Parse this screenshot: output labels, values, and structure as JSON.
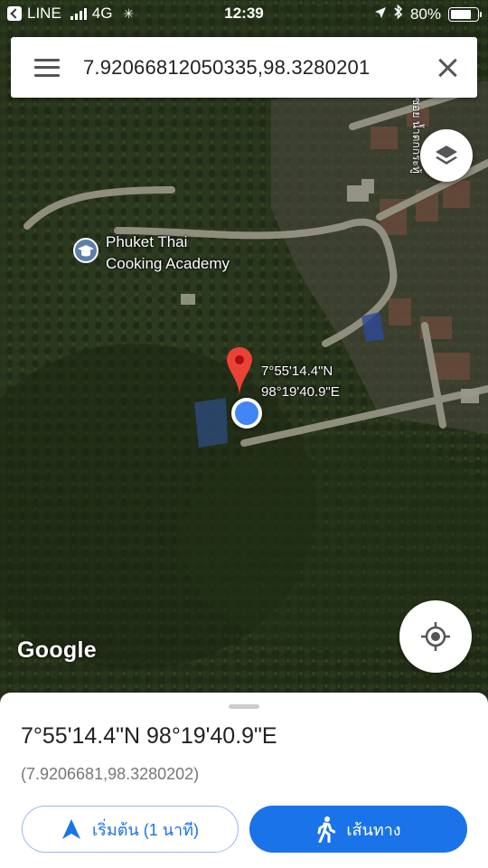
{
  "status_bar": {
    "back_app": "LINE",
    "network": "4G",
    "time": "12:39",
    "battery": "80%",
    "battery_level": 0.8
  },
  "search": {
    "query": "7.92066812050335,98.3280201"
  },
  "map": {
    "poi_name_line1": "Phuket Thai",
    "poi_name_line2": "Cooking Academy",
    "pin_label_line1": "7°55'14.4\"N",
    "pin_label_line2": "98°19'40.9\"E",
    "road_label": "ซอย น้ำตกกระทู้",
    "attribution": "Google"
  },
  "bottom_sheet": {
    "title": "7°55'14.4\"N 98°19'40.9\"E",
    "decimal_coords": "(7.9206681,98.3280202)",
    "start_label": "เริ่มต้น (1 นาที)",
    "directions_label": "เส้นทาง"
  },
  "colors": {
    "accent": "#1a73e8",
    "pin": "#ea4335",
    "my_location": "#4285f4"
  }
}
